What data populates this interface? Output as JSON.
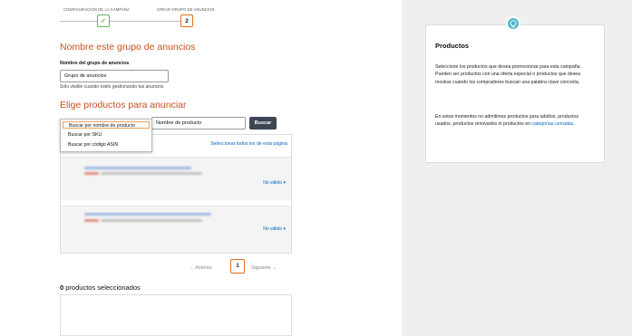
{
  "steps": [
    {
      "label": "CONFIGURACIÓN DE LA CAMPAÑA",
      "marker": "✓",
      "state": "complete"
    },
    {
      "label": "CREAR GRUPO DE ANUNCIOS",
      "marker": "2",
      "state": "current"
    }
  ],
  "ad_group": {
    "heading": "Nombre este grupo de anuncios",
    "field_label": "Nombre del grupo de anuncios",
    "field_value": "Grupo de anuncios",
    "helper_text": "Sólo visible cuando estés gestionando tus anuncios"
  },
  "products": {
    "heading": "Elige productos para anunciar",
    "search_by_options": [
      "Buscar por nombre de producto",
      "Buscar por SKU",
      "Buscar por código ASIN"
    ],
    "search_by_selected": "Buscar por nombre de producto",
    "search_placeholder": "Nombre de producto",
    "search_button": "Buscar",
    "sort_indicator": "s ⇕",
    "select_all_link": "Seleccionar todos los de esta página",
    "rows": [
      {
        "status": "No válido ▾"
      },
      {
        "status": "No válido ▾"
      }
    ],
    "pagination": {
      "prev": "← Anterior",
      "current_page": "1",
      "next": "Siguiente →"
    }
  },
  "selected": {
    "count": "0",
    "label": " productos seleccionados"
  },
  "info_panel": {
    "icon": "lightbulb-icon",
    "title": "Productos",
    "paragraph1": "Seleccione los productos que desea promocionar para esta campaña. Pueden ser productos con una oferta especial o productos que desea mostrar cuando los compradores buscan una palabra clave concreta.",
    "paragraph2_text": "En estos momentos no admitimos productos para adultos, productos usados, productos renovados ni productos en ",
    "paragraph2_link": "categorías cerradas",
    "paragraph2_end": "."
  },
  "colors": {
    "accent": "#c7511f",
    "step_border": "#e06d18",
    "step_done": "#5fb35f",
    "link": "#0066c0",
    "button_dark": "#3c4654",
    "panel_bg": "#efefef",
    "bulb": "#4fb7c7"
  }
}
